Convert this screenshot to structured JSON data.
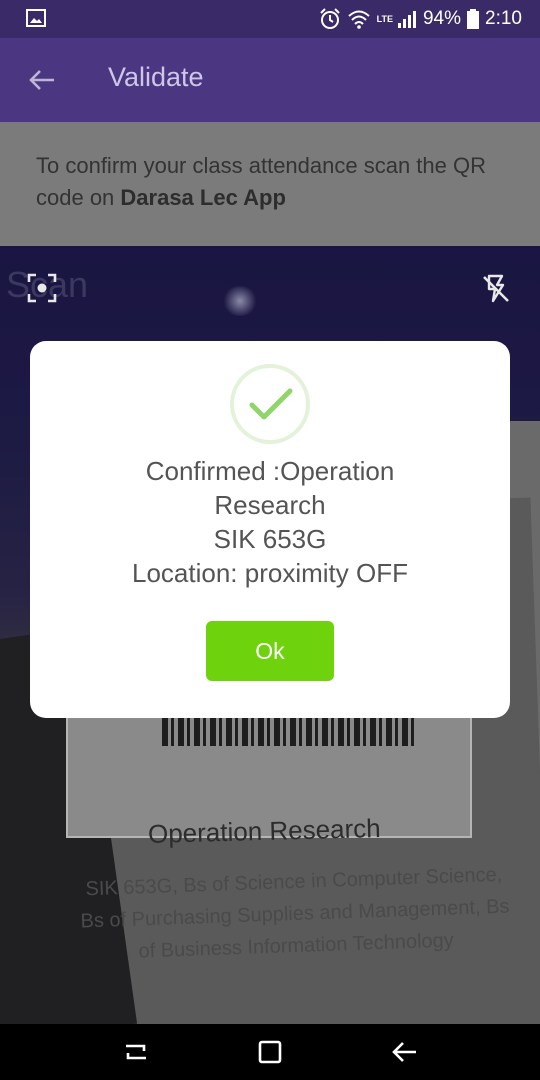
{
  "status_bar": {
    "network": "LTE",
    "battery": "94%",
    "time": "2:10",
    "icons": [
      "image-icon",
      "alarm-icon",
      "wifi-icon",
      "signal-icon",
      "battery-icon"
    ]
  },
  "app_bar": {
    "title": "Validate",
    "back_icon": "arrow-back-icon"
  },
  "instruction": {
    "text_before": "To confirm your class attendance scan the QR code on ",
    "app_name": "Darasa Lec App"
  },
  "camera": {
    "scan_ghost": "Scan",
    "course_name": "Operation Research",
    "course_desc": "SIK 653G, Bs of Science in Computer Science, Bs of Purchasing Supplies and Management, Bs of Business Information Technology",
    "focus_icon": "focus-icon",
    "flash_icon": "flash-off-icon"
  },
  "dialog": {
    "icon": "check-icon",
    "message": "Confirmed :Operation\nResearch\n SIK 653G\nLocation: proximity OFF",
    "ok_label": "Ok",
    "accent_color": "#6ed20c"
  },
  "nav_bar": {
    "icons": [
      "recents-icon",
      "home-icon",
      "back-icon"
    ]
  }
}
